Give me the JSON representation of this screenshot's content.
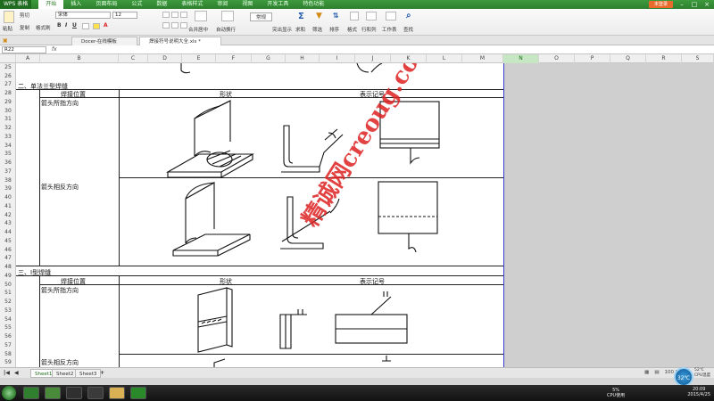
{
  "titlebar": {
    "app": "WPS 表格",
    "menus": [
      "开始",
      "插入",
      "页面布局",
      "公式",
      "数据",
      "表格样式",
      "审阅",
      "视图",
      "开发工具",
      "特色功能"
    ],
    "active_menu": "开始",
    "login": "未登录"
  },
  "ribbon": {
    "font_name": "宋体",
    "font_size": "12",
    "cut": "剪切",
    "copy": "复制",
    "format_painter": "格式刷",
    "paste": "粘贴",
    "merge_center": "合并居中",
    "wrap": "自动换行",
    "sum": "求和",
    "filter": "筛选",
    "sort": "排序",
    "format": "格式",
    "row_col": "行和列",
    "worksheet": "工作表",
    "find": "查找",
    "cond_format": "常规",
    "show_all": "突出显示"
  },
  "tabs": {
    "docer": "Docer-在线模板",
    "file": "焊接符号说明大全.xls *"
  },
  "formula": {
    "namebox": "R22",
    "fx": "fx"
  },
  "columns": [
    "A",
    "B",
    "C",
    "D",
    "E",
    "F",
    "G",
    "H",
    "I",
    "J",
    "K",
    "L",
    "M",
    "N",
    "O",
    "P",
    "Q",
    "R",
    "S"
  ],
  "selected_column": "N",
  "rows": [
    "25",
    "26",
    "27",
    "28",
    "29",
    "30",
    "31",
    "32",
    "33",
    "34",
    "35",
    "36",
    "37",
    "38",
    "39",
    "40",
    "41",
    "42",
    "43",
    "44",
    "45",
    "46",
    "47",
    "48",
    "49",
    "50",
    "51",
    "52",
    "53",
    "54",
    "55",
    "56",
    "57",
    "58",
    "59"
  ],
  "content": {
    "section1": "二、单法兰型焊缝",
    "section2": "三、I型焊缝",
    "h_pos": "焊接位置",
    "h_shape": "形状",
    "h_symbol": "表示记号",
    "arrow_side": "箭头所指方向",
    "other_side": "箭头相反方向"
  },
  "watermark": "精诚网creoug.com",
  "sheets": [
    "Sheet1",
    "Sheet2",
    "Sheet3"
  ],
  "active_sheet": "Sheet1",
  "status": {
    "zoom": "100 %",
    "cpu": "5%",
    "cpu_label": "CPU使用",
    "badge": "32℃",
    "badge_label1": "52℃",
    "badge_label2": "CPU温度"
  },
  "clock": {
    "time": "20:09",
    "date": "2015/4/25"
  }
}
